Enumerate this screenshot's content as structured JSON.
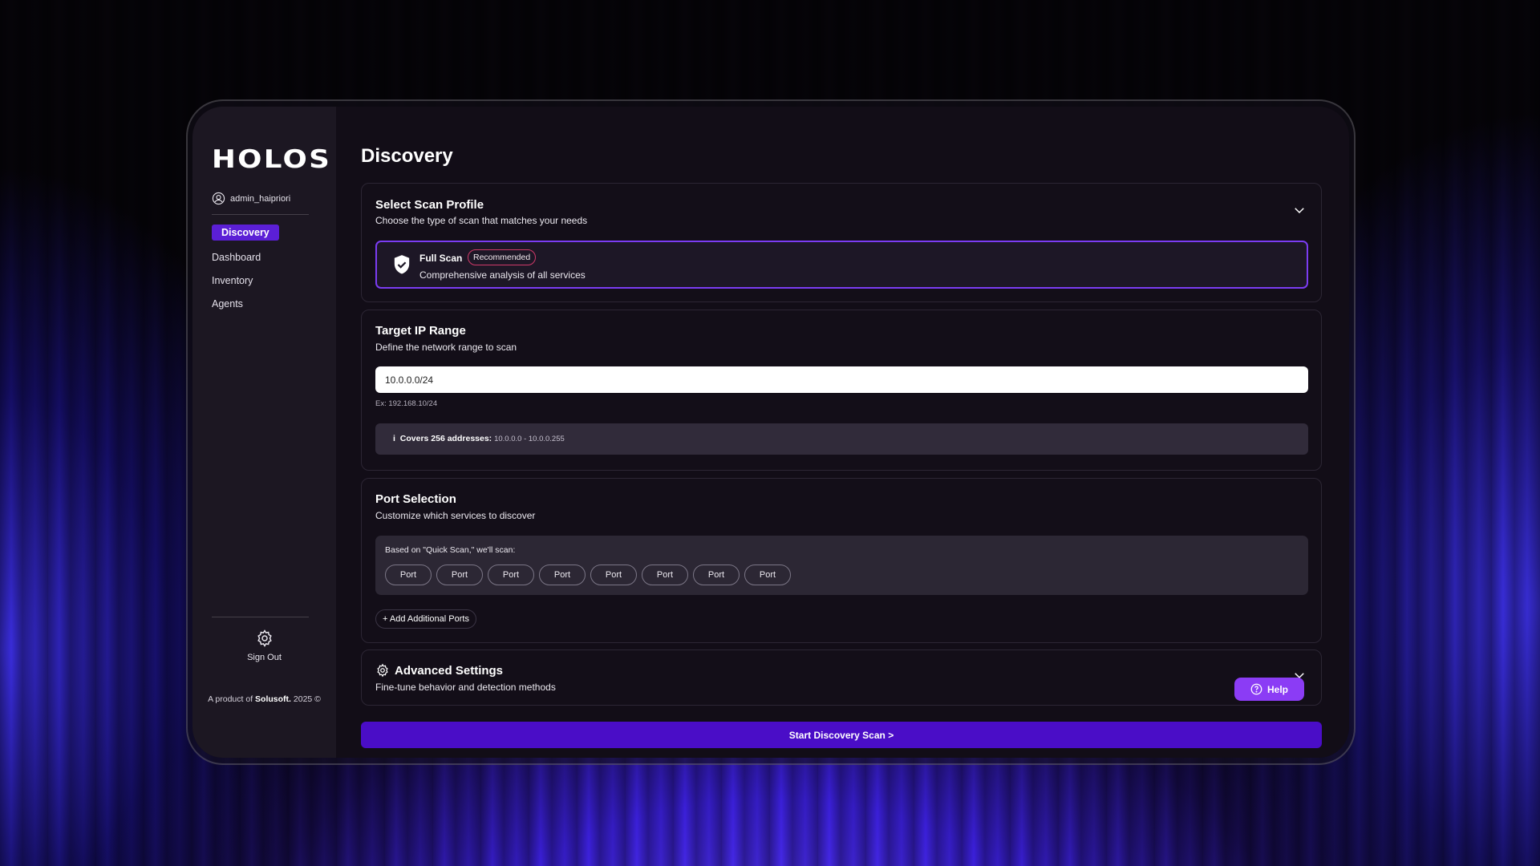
{
  "app": {
    "logo_text": "HOLOS",
    "username": "admin_haipriori"
  },
  "sidebar": {
    "items": [
      {
        "label": "Discovery",
        "active": true
      },
      {
        "label": "Dashboard"
      },
      {
        "label": "Inventory"
      },
      {
        "label": "Agents"
      }
    ],
    "sign_out_label": "Sign Out",
    "footer_prefix": "A product of",
    "footer_brand": "Solusoft.",
    "footer_year": "2025 ©"
  },
  "main": {
    "page_title": "Discovery",
    "scan_profile": {
      "title": "Select Scan Profile",
      "subtitle": "Choose the type of scan that matches your needs",
      "selected_option": {
        "name": "Full Scan",
        "badge": "Recommended",
        "description": "Comprehensive analysis of all services"
      }
    },
    "target_ip": {
      "title": "Target IP Range",
      "subtitle": "Define the network range to scan",
      "input_value": "10.0.0.0/24",
      "hint": "Ex: 192.168.10/24",
      "info_icon": "i",
      "info_label": "Covers 256 addresses:",
      "info_range": "10.0.0.0 - 10.0.0.255"
    },
    "port_selection": {
      "title": "Port Selection",
      "subtitle": "Customize which services to discover",
      "based_on_text": "Based on \"Quick Scan,\" we'll scan:",
      "ports": [
        "Port",
        "Port",
        "Port",
        "Port",
        "Port",
        "Port",
        "Port",
        "Port"
      ],
      "add_button": "+ Add Additional Ports"
    },
    "advanced": {
      "title": "Advanced Settings",
      "subtitle": "Fine-tune behavior and detection methods"
    },
    "help_label": "Help",
    "start_button": "Start Discovery Scan >"
  },
  "colors": {
    "accent": "#5b1fd6",
    "start_button": "#4a0dc7",
    "help_button": "#8b3cf5",
    "selected_border": "#7b3cf2",
    "badge_border": "#d13a6a"
  },
  "icons": [
    "user-icon",
    "gear-icon",
    "shield-icon",
    "chevron-down-icon",
    "info-icon",
    "help-circle-icon"
  ]
}
